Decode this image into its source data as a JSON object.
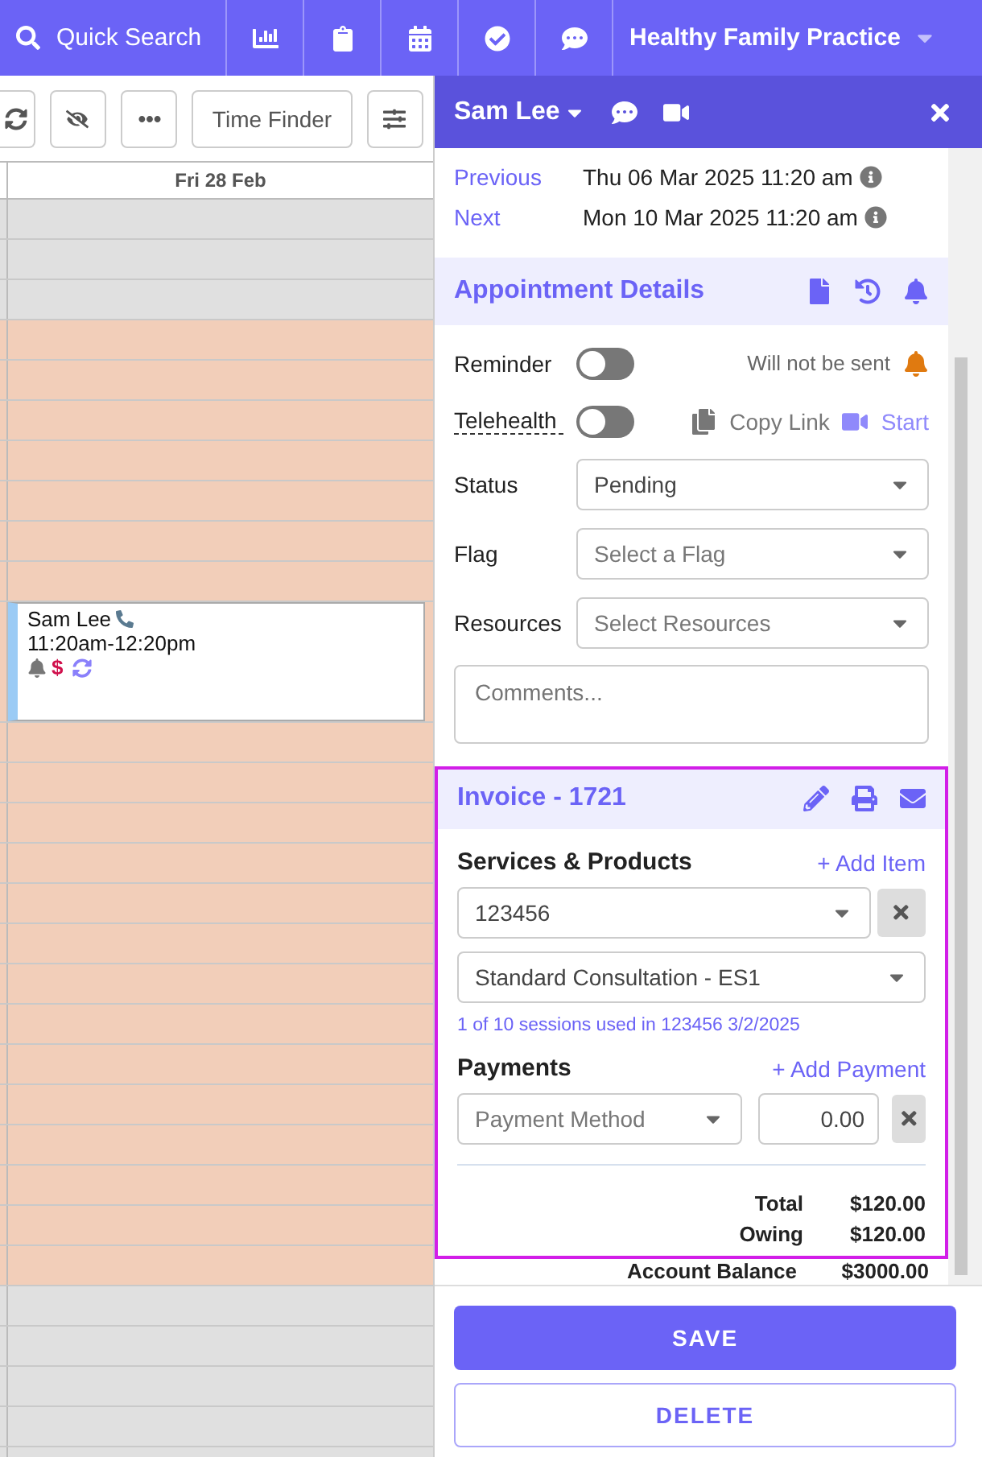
{
  "top_bar": {
    "search": "Quick Search",
    "practice": "Healthy Family Practice"
  },
  "toolbar": {
    "time_finder": "Time Finder"
  },
  "calendar": {
    "day": "Fri 28 Feb",
    "slots": [
      {
        "available": false
      },
      {
        "available": false
      },
      {
        "available": false
      },
      {
        "available": true
      },
      {
        "available": true
      },
      {
        "available": true
      },
      {
        "available": true
      },
      {
        "available": true
      },
      {
        "available": true
      },
      {
        "available": true
      },
      {
        "available": true,
        "appointment": {
          "name": "Sam Lee",
          "time": "11:20am-12:20pm",
          "currency": "$"
        }
      },
      {
        "available": true
      },
      {
        "available": true
      },
      {
        "available": true
      },
      {
        "available": true
      },
      {
        "available": true
      },
      {
        "available": true
      },
      {
        "available": true
      },
      {
        "available": true
      },
      {
        "available": true
      },
      {
        "available": true
      },
      {
        "available": true
      },
      {
        "available": true
      },
      {
        "available": true
      },
      {
        "available": true
      },
      {
        "available": false
      },
      {
        "available": false
      },
      {
        "available": false
      },
      {
        "available": false
      },
      {
        "available": false
      }
    ]
  },
  "panel": {
    "patient": "Sam Lee",
    "previous": {
      "label": "Previous",
      "value": "Thu 06 Mar 2025 11:20 am"
    },
    "next": {
      "label": "Next",
      "value": "Mon 10 Mar 2025 11:20 am"
    },
    "details_title": "Appointment Details",
    "reminder": {
      "label": "Reminder",
      "on": false,
      "note": "Will not be sent"
    },
    "telehealth": {
      "label": "Telehealth",
      "on": false,
      "copy": "Copy Link",
      "start": "Start"
    },
    "selects": [
      {
        "label": "Status",
        "value": "Pending"
      },
      {
        "label": "Flag",
        "placeholder": "Select a Flag"
      },
      {
        "label": "Resources",
        "placeholder": "Select Resources"
      }
    ],
    "comments": {
      "placeholder": "Comments..."
    },
    "invoice": {
      "title": "Invoice - 1721",
      "services_title": "Services & Products",
      "add_item": "+ Add Item",
      "item_code": "123456",
      "item_service": "Standard Consultation - ES1",
      "sessions": "1 of 10 sessions used in 123456 3/2/2025",
      "payments_title": "Payments",
      "add_payment": "+ Add Payment",
      "payment_method": {
        "placeholder": "Payment Method"
      },
      "amount": "0.00",
      "totals": [
        {
          "label": "Total",
          "value": "$120.00"
        },
        {
          "label": "Owing",
          "value": "$120.00"
        }
      ]
    },
    "account_balance": {
      "label": "Account Balance",
      "value": "$3000.00"
    },
    "save": "SAVE",
    "delete": "DELETE"
  }
}
